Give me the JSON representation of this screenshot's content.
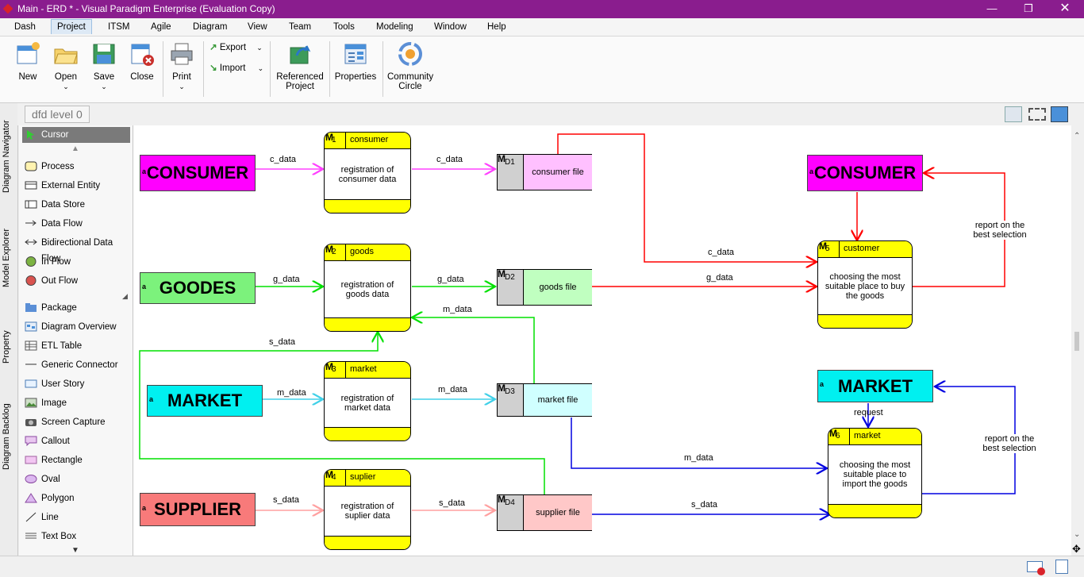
{
  "window": {
    "title": "Main - ERD * - Visual Paradigm Enterprise (Evaluation Copy)"
  },
  "menu": [
    "Dash",
    "Project",
    "ITSM",
    "Agile",
    "Diagram",
    "View",
    "Team",
    "Tools",
    "Modeling",
    "Window",
    "Help"
  ],
  "ribbon": {
    "new": "New",
    "open": "Open",
    "save": "Save",
    "close": "Close",
    "print": "Print",
    "export": "Export",
    "import": "Import",
    "referenced_1": "Referenced",
    "referenced_2": "Project",
    "properties": "Properties",
    "community_1": "Community",
    "community_2": "Circle"
  },
  "diagram_tab": "dfd level 0",
  "side_tabs": [
    "Diagram Navigator",
    "Model Explorer",
    "Property",
    "Diagram Backlog"
  ],
  "palette": [
    "Cursor",
    "Process",
    "External Entity",
    "Data Store",
    "Data Flow",
    "Bidirectional Data Flow",
    "In Flow",
    "Out Flow",
    "Package",
    "Diagram Overview",
    "ETL Table",
    "Generic Connector",
    "User Story",
    "Image",
    "Screen Capture",
    "Callout",
    "Rectangle",
    "Oval",
    "Polygon",
    "Line",
    "Text Box"
  ],
  "entities": {
    "consumer_left": "CONSUMER",
    "goodes": "GOODES",
    "market_left": "MARKET",
    "supplier": "SUPPLIER",
    "consumer_right": "CONSUMER",
    "market_right": "MARKET",
    "marker": "a"
  },
  "processes": [
    {
      "num": "1",
      "name": "consumer",
      "desc": "registration of consumer data"
    },
    {
      "num": "2",
      "name": "goods",
      "desc": "registration of goods data"
    },
    {
      "num": "3",
      "name": "market",
      "desc": "registration of market data"
    },
    {
      "num": "4",
      "name": "suplier",
      "desc": "registration of suplier data"
    },
    {
      "num": "5",
      "name": "customer",
      "desc": "choosing the most suitable place to buy the goods"
    },
    {
      "num": "6",
      "name": "market",
      "desc": "choosing the most suitable place to import the goods"
    }
  ],
  "process_marker": "M",
  "stores": [
    {
      "id": "D1",
      "name": "consumer file"
    },
    {
      "id": "D2",
      "name": "goods file"
    },
    {
      "id": "D3",
      "name": "market file"
    },
    {
      "id": "D4",
      "name": "supplier file"
    }
  ],
  "flows": {
    "c_data": "c_data",
    "g_data": "g_data",
    "m_data": "m_data",
    "s_data": "s_data",
    "request": "request",
    "report_1": "report on the",
    "report_2": "best selection"
  },
  "colors": {
    "titlebar": "#8a1d8e",
    "consumer": "#ff00ff",
    "goodes": "#7cf27c",
    "market": "#00f0f0",
    "supplier": "#f87a7a",
    "process_header": "#ffff00",
    "flow_red": "#ff0000",
    "flow_blue": "#0000e0",
    "flow_green": "#00ff00",
    "flow_magenta": "#ff40ff",
    "flow_cyan": "#40e0f0",
    "flow_pink": "#ffb0b0"
  }
}
